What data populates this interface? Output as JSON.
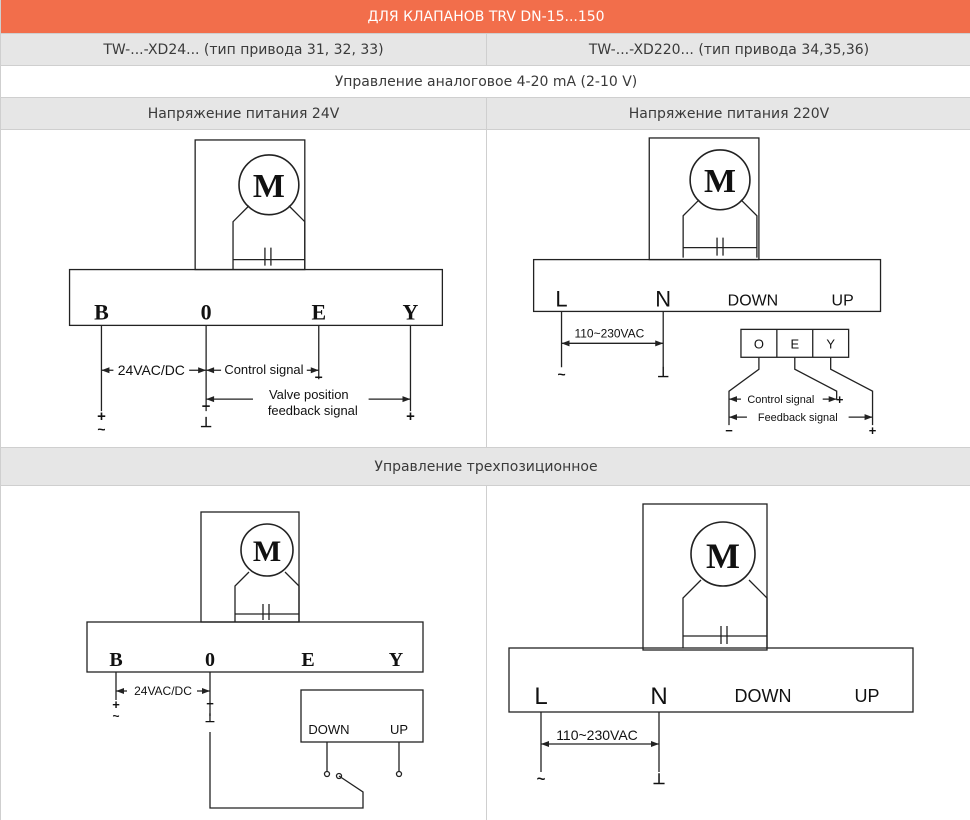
{
  "header": {
    "title": "ДЛЯ КЛАПАНОВ TRV DN-15...150"
  },
  "models": {
    "left": "TW-...-XD24... (тип привода 31, 32, 33)",
    "right": "TW-...-XD220... (тип привода 34,35,36)"
  },
  "analog": {
    "title": "Управление аналоговое 4-20 mA (2-10 V)",
    "left_voltage": "Напряжение питания 24V",
    "right_voltage": "Напряжение питания 220V"
  },
  "three_pos": {
    "title": "Управление трехпозиционное"
  },
  "diagram": {
    "motor_label": "M",
    "term_b": "B",
    "term_o": "0",
    "term_e": "E",
    "term_y": "Y",
    "term_l": "L",
    "term_n": "N",
    "term_down": "DOWN",
    "term_up": "UP",
    "box_o": "O",
    "box_e": "E",
    "box_y": "Y",
    "supply_24": "24VAC/DC",
    "supply_220": "110~230VAC",
    "control_signal": "Control signal",
    "valve_position": "Valve position",
    "feedback_signal_lower": "feedback signal",
    "feedback_signal": "Feedback signal",
    "plus": "+",
    "minus": "−",
    "tilde": "~",
    "ground": "⊥"
  }
}
